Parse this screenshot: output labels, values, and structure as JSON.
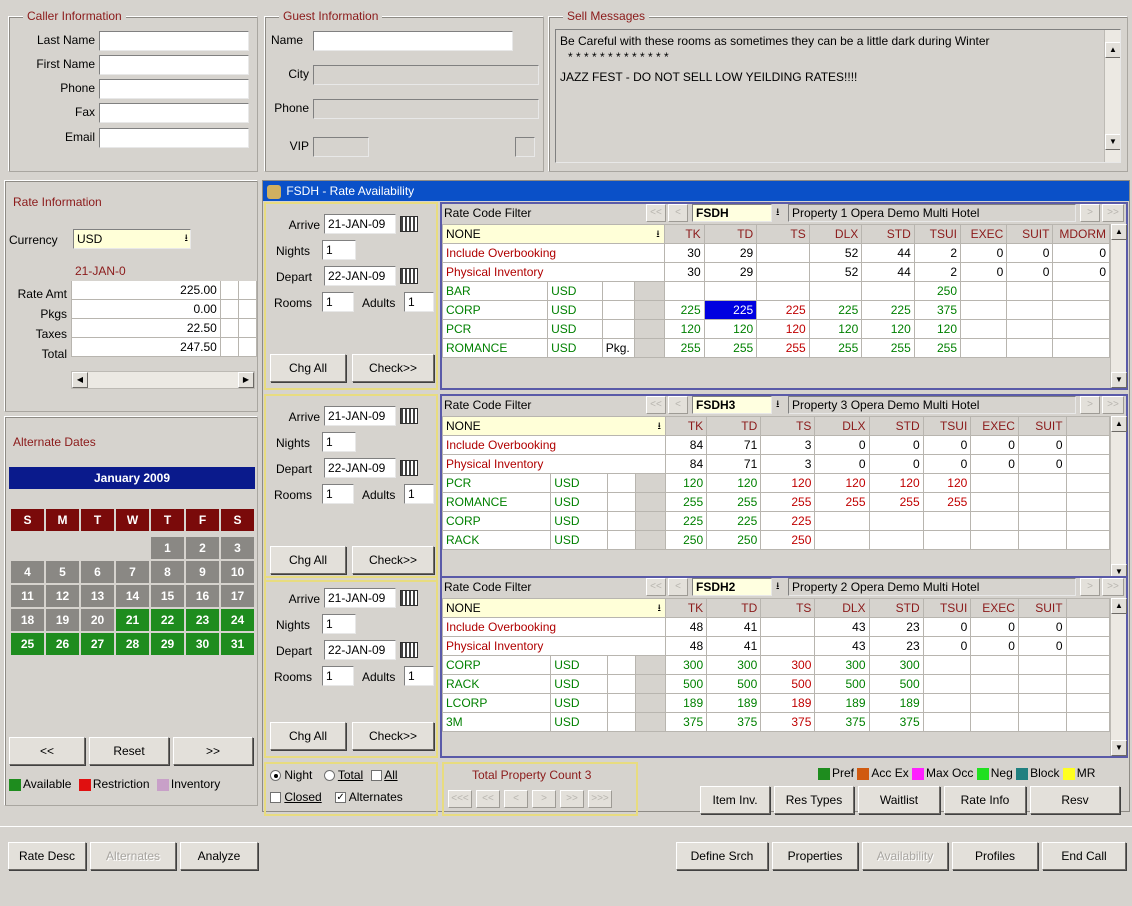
{
  "caller": {
    "title": "Caller Information",
    "last_name": "Last Name",
    "first_name": "First Name",
    "phone": "Phone",
    "fax": "Fax",
    "email": "Email"
  },
  "guest": {
    "title": "Guest Information",
    "name": "Name",
    "city": "City",
    "phone": "Phone",
    "vip": "VIP"
  },
  "sell": {
    "title": "Sell Messages",
    "line1": "Be Careful with these rooms as sometimes they can be a little dark during Winter",
    "line2": "* * * * * * * * * * * * *",
    "line3": "JAZZ FEST - DO NOT SELL LOW YEILDING RATES!!!!"
  },
  "rate_info": {
    "title": "Rate Information",
    "currency_label": "Currency",
    "currency": "USD",
    "date": "21-JAN-0",
    "rows": [
      {
        "label": "Rate Amt",
        "value": "225.00"
      },
      {
        "label": "Pkgs",
        "value": "0.00"
      },
      {
        "label": "Taxes",
        "value": "22.50"
      },
      {
        "label": "Total",
        "value": "247.50"
      }
    ]
  },
  "alt_dates": {
    "title": "Alternate Dates",
    "month": "January 2009",
    "days": [
      "S",
      "M",
      "T",
      "W",
      "T",
      "F",
      "S"
    ],
    "weeks": [
      [
        "",
        "",
        "",
        "",
        "1",
        "2",
        "3"
      ],
      [
        "4",
        "5",
        "6",
        "7",
        "8",
        "9",
        "10"
      ],
      [
        "11",
        "12",
        "13",
        "14",
        "15",
        "16",
        "17"
      ],
      [
        "18",
        "19",
        "20",
        "21",
        "22",
        "23",
        "24"
      ],
      [
        "25",
        "26",
        "27",
        "28",
        "29",
        "30",
        "31"
      ]
    ],
    "prev": "<<",
    "reset": "Reset",
    "next": ">>",
    "legend": [
      "Available",
      "Restriction",
      "Inventory"
    ]
  },
  "window_title": "FSDH - Rate Availability",
  "panels": [
    {
      "arrive": "21-JAN-09",
      "nights": "1",
      "depart": "22-JAN-09",
      "rooms": "1",
      "adults": "1",
      "filter_label": "Rate Code Filter",
      "property_code": "FSDH",
      "property_name": "Property 1 Opera Demo Multi Hotel",
      "filter_value": "NONE",
      "cols": [
        "TK",
        "TD",
        "TS",
        "DLX",
        "STD",
        "TSUI",
        "EXEC",
        "SUIT",
        "MDORM"
      ],
      "rows": [
        {
          "name": "Include Overbooking",
          "cur": "",
          "pkg": "",
          "v": [
            "30",
            "29",
            "",
            "52",
            "44",
            "2",
            "0",
            "0",
            "0"
          ],
          "style": "hdr"
        },
        {
          "name": "Physical Inventory",
          "cur": "",
          "pkg": "",
          "v": [
            "30",
            "29",
            "",
            "52",
            "44",
            "2",
            "0",
            "0",
            "0"
          ],
          "style": "hdr"
        },
        {
          "name": "BAR",
          "cur": "USD",
          "pkg": "",
          "v": [
            "",
            "",
            "",
            "",
            "",
            "250",
            "",
            "",
            ""
          ],
          "style": "grn"
        },
        {
          "name": "CORP",
          "cur": "USD",
          "pkg": "",
          "v": [
            "225",
            "225",
            "225",
            "225",
            "225",
            "375",
            "",
            "",
            ""
          ],
          "style": "grn"
        },
        {
          "name": "PCR",
          "cur": "USD",
          "pkg": "",
          "v": [
            "120",
            "120",
            "120",
            "120",
            "120",
            "120",
            "",
            "",
            ""
          ],
          "style": "grn"
        },
        {
          "name": "ROMANCE",
          "cur": "USD",
          "pkg": "Pkg.",
          "v": [
            "255",
            "255",
            "255",
            "255",
            "255",
            "255",
            "",
            "",
            ""
          ],
          "style": "grn"
        }
      ]
    },
    {
      "arrive": "21-JAN-09",
      "nights": "1",
      "depart": "22-JAN-09",
      "rooms": "1",
      "adults": "1",
      "filter_label": "Rate Code Filter",
      "property_code": "FSDH3",
      "property_name": "Property 3 Opera Demo Multi Hotel",
      "filter_value": "NONE",
      "cols": [
        "TK",
        "TD",
        "TS",
        "DLX",
        "STD",
        "TSUI",
        "EXEC",
        "SUIT",
        ""
      ],
      "rows": [
        {
          "name": "Include Overbooking",
          "cur": "",
          "pkg": "",
          "v": [
            "84",
            "71",
            "3",
            "0",
            "0",
            "0",
            "0",
            "0",
            ""
          ],
          "style": "hdr"
        },
        {
          "name": "Physical Inventory",
          "cur": "",
          "pkg": "",
          "v": [
            "84",
            "71",
            "3",
            "0",
            "0",
            "0",
            "0",
            "0",
            ""
          ],
          "style": "hdr"
        },
        {
          "name": "PCR",
          "cur": "USD",
          "pkg": "",
          "v": [
            "120",
            "120",
            "120",
            "120",
            "120",
            "120",
            "",
            "",
            ""
          ],
          "style": "grn"
        },
        {
          "name": "ROMANCE",
          "cur": "USD",
          "pkg": "",
          "v": [
            "255",
            "255",
            "255",
            "255",
            "255",
            "255",
            "",
            "",
            ""
          ],
          "style": "grn"
        },
        {
          "name": "CORP",
          "cur": "USD",
          "pkg": "",
          "v": [
            "225",
            "225",
            "225",
            "",
            "",
            "",
            "",
            "",
            ""
          ],
          "style": "grn"
        },
        {
          "name": "RACK",
          "cur": "USD",
          "pkg": "",
          "v": [
            "250",
            "250",
            "250",
            "",
            "",
            "",
            "",
            "",
            ""
          ],
          "style": "grn"
        }
      ]
    },
    {
      "arrive": "21-JAN-09",
      "nights": "1",
      "depart": "22-JAN-09",
      "rooms": "1",
      "adults": "1",
      "filter_label": "Rate Code Filter",
      "property_code": "FSDH2",
      "property_name": "Property 2 Opera Demo Multi Hotel",
      "filter_value": "NONE",
      "cols": [
        "TK",
        "TD",
        "TS",
        "DLX",
        "STD",
        "TSUI",
        "EXEC",
        "SUIT",
        ""
      ],
      "rows": [
        {
          "name": "Include Overbooking",
          "cur": "",
          "pkg": "",
          "v": [
            "48",
            "41",
            "",
            "43",
            "23",
            "0",
            "0",
            "0",
            ""
          ],
          "style": "hdr"
        },
        {
          "name": "Physical Inventory",
          "cur": "",
          "pkg": "",
          "v": [
            "48",
            "41",
            "",
            "43",
            "23",
            "0",
            "0",
            "0",
            ""
          ],
          "style": "hdr"
        },
        {
          "name": "CORP",
          "cur": "USD",
          "pkg": "",
          "v": [
            "300",
            "300",
            "300",
            "300",
            "300",
            "",
            "",
            "",
            ""
          ],
          "style": "grn"
        },
        {
          "name": "RACK",
          "cur": "USD",
          "pkg": "",
          "v": [
            "500",
            "500",
            "500",
            "500",
            "500",
            "",
            "",
            "",
            ""
          ],
          "style": "grn"
        },
        {
          "name": "LCORP",
          "cur": "USD",
          "pkg": "",
          "v": [
            "189",
            "189",
            "189",
            "189",
            "189",
            "",
            "",
            "",
            ""
          ],
          "style": "grn"
        },
        {
          "name": "3M",
          "cur": "USD",
          "pkg": "",
          "v": [
            "375",
            "375",
            "375",
            "375",
            "375",
            "",
            "",
            "",
            ""
          ],
          "style": "grn"
        }
      ]
    }
  ],
  "labels": {
    "arrive": "Arrive",
    "nights": "Nights",
    "depart": "Depart",
    "rooms": "Rooms",
    "adults": "Adults",
    "chg_all": "Chg All",
    "check": "Check>>"
  },
  "options": {
    "night": "Night",
    "total": "Total",
    "all": "All",
    "closed": "Closed",
    "alternates": "Alternates"
  },
  "total_count": "Total Property Count 3",
  "color_legend": [
    "Pref",
    "Acc Ex",
    "Max Occ",
    "Neg",
    "Block",
    "MR"
  ],
  "action_buttons": [
    "Item Inv.",
    "Res Types",
    "Waitlist",
    "Rate Info",
    "Resv"
  ],
  "bottom_left": [
    "Rate Desc",
    "Alternates",
    "Analyze"
  ],
  "bottom_right": [
    "Define Srch",
    "Properties",
    "Availability",
    "Profiles",
    "End Call"
  ],
  "colors": {
    "available": "#1e8c1e",
    "restriction": "#e01010",
    "inventory": "#c8a0c8",
    "title_bar": "#0a50c8",
    "month_bar": "#0a1a8c"
  }
}
